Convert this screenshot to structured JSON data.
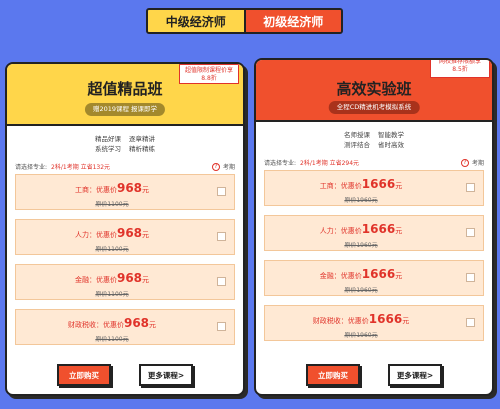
{
  "tabs": [
    "中级经济师",
    "初级经济师"
  ],
  "cards": [
    {
      "title": "超值精品班",
      "pill": "赠2019课程 报课即学",
      "ribbon": [
        "超值限制课程价享",
        "8.8折"
      ],
      "features": [
        [
          "精品好课",
          "逐章精讲"
        ],
        [
          "系统学习",
          "精析精练"
        ]
      ],
      "select_label": "请选择专业:",
      "select_meta": "2科/1考期 立省132元",
      "exam_label": "考期",
      "options": [
        {
          "name": "工商",
          "label": "优惠价",
          "price": "968",
          "unit": "元",
          "old": "原价1100元"
        },
        {
          "name": "人力",
          "label": "优惠价",
          "price": "968",
          "unit": "元",
          "old": "原价1100元"
        },
        {
          "name": "金融",
          "label": "优惠价",
          "price": "968",
          "unit": "元",
          "old": "原价1100元"
        },
        {
          "name": "财政税收",
          "label": "优惠价",
          "price": "968",
          "unit": "元",
          "old": "原价1100元"
        }
      ],
      "buy": "立即购买",
      "more": "更多课程>"
    },
    {
      "title": "高效实验班",
      "pill": "全程CD精进机考模拟系统",
      "ribbon": [
        "网校推荐限额享",
        "8.5折"
      ],
      "features": [
        [
          "名师授课",
          "智能教学"
        ],
        [
          "测评结合",
          "省时高效"
        ]
      ],
      "select_label": "请选择专业:",
      "select_meta": "2科/1考期 立省294元",
      "exam_label": "考期",
      "options": [
        {
          "name": "工商",
          "label": "优惠价",
          "price": "1666",
          "unit": "元",
          "old": "原价1960元"
        },
        {
          "name": "人力",
          "label": "优惠价",
          "price": "1666",
          "unit": "元",
          "old": "原价1960元"
        },
        {
          "name": "金融",
          "label": "优惠价",
          "price": "1666",
          "unit": "元",
          "old": "原价1960元"
        },
        {
          "name": "财政税收",
          "label": "优惠价",
          "price": "1666",
          "unit": "元",
          "old": "原价1960元"
        }
      ],
      "buy": "立即购买",
      "more": "更多课程>"
    }
  ]
}
